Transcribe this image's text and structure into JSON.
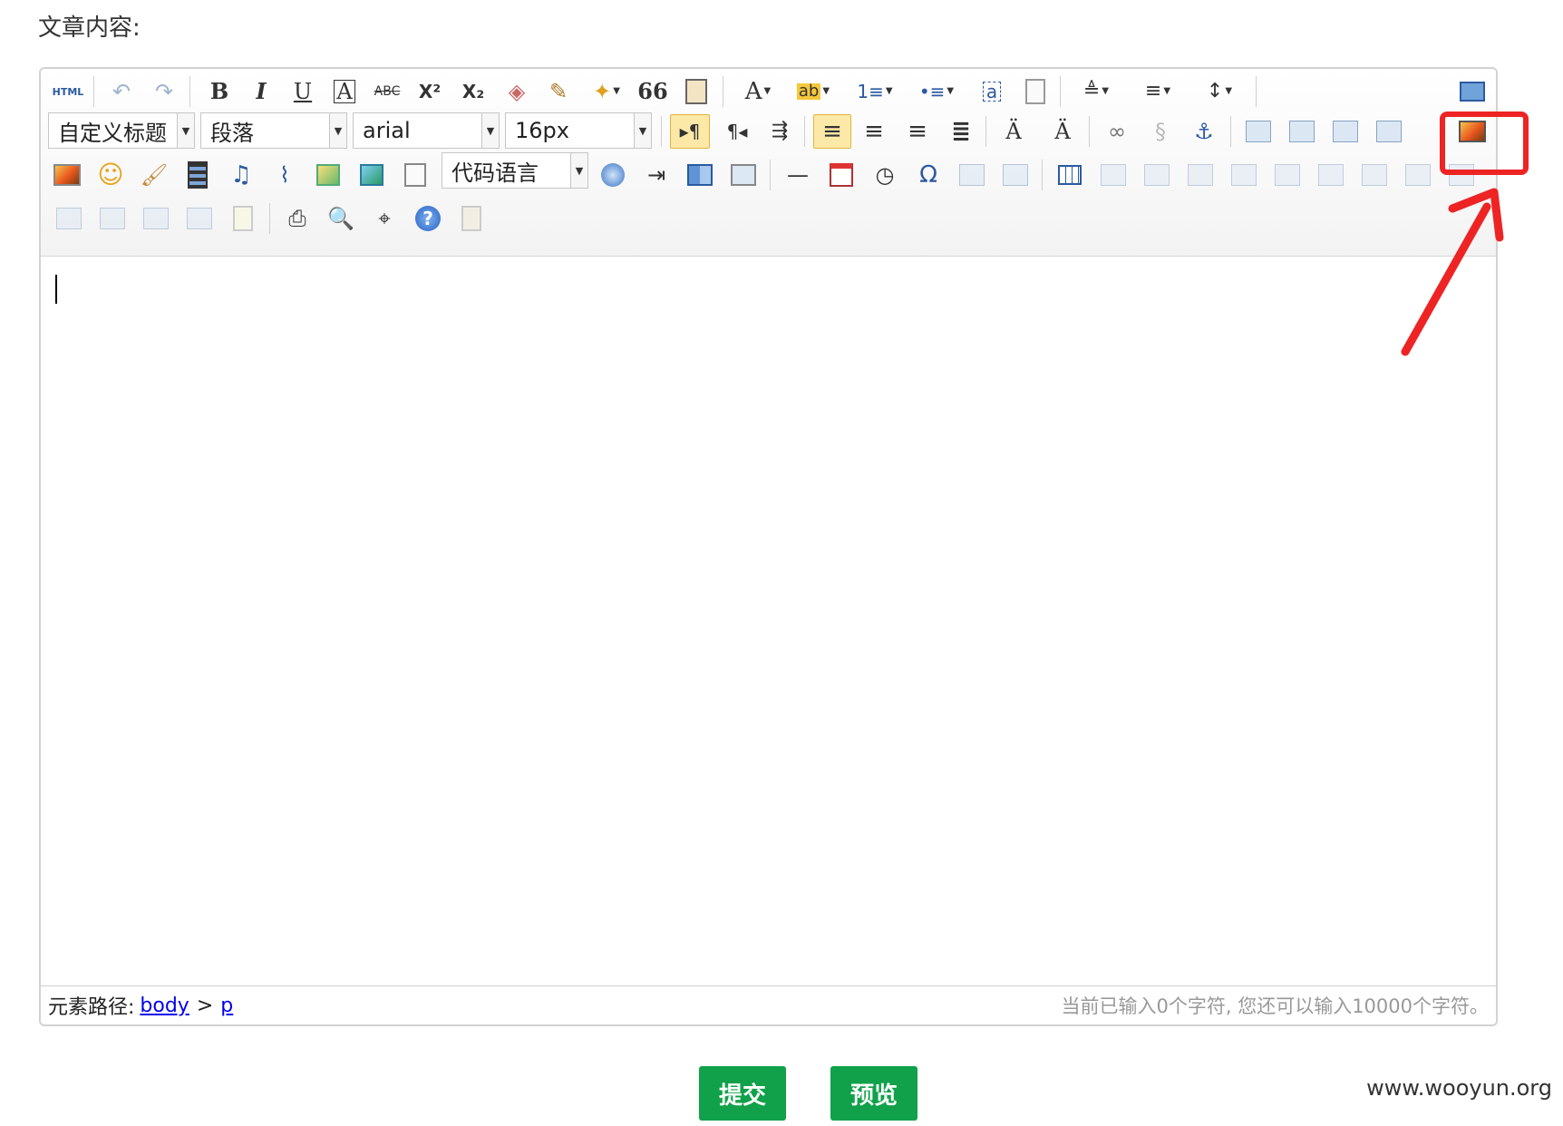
{
  "page": {
    "label": "文章内容:",
    "watermark": "www.wooyun.org"
  },
  "toolbar": {
    "html_label": "HTML",
    "combos": {
      "custom_heading": "自定义标题",
      "paragraph": "段落",
      "font_family": "arial",
      "font_size": "16px",
      "code_language": "代码语言"
    },
    "glyphs": {
      "bold": "B",
      "italic": "I",
      "underline": "U",
      "font_border": "A",
      "strikethrough": "ABC",
      "superscript": "X²",
      "subscript": "X₂",
      "blockquote": "66",
      "font_color": "A",
      "backcolor": "ab",
      "ordered_list": "1≡",
      "unordered_list": "•≡",
      "ltr": "▸¶",
      "rtl": "¶◂",
      "omega": "Ω",
      "help": "?",
      "horizontal": "—"
    },
    "row_icons": [
      [
        "html-source-icon",
        "undo-icon",
        "redo-icon",
        "bold-icon",
        "italic-icon",
        "underline-icon",
        "fontborder-icon",
        "strikethrough-icon",
        "superscript-icon",
        "subscript-icon",
        "eraser-icon",
        "format-brush-icon",
        "auto-format-icon",
        "blockquote-icon",
        "paste-plain-icon",
        "font-color-icon",
        "background-color-icon",
        "ordered-list-icon",
        "unordered-list-icon",
        "select-all-icon",
        "clear-doc-icon",
        "row-spacing-top-icon",
        "row-spacing-bottom-icon",
        "line-height-icon",
        "fullscreen-icon"
      ],
      [
        "custom-heading-select",
        "paragraph-select",
        "font-family-select",
        "font-size-select",
        "direction-ltr-icon",
        "direction-rtl-icon",
        "indent-icon",
        "justify-left-icon",
        "justify-center-icon",
        "justify-right-icon",
        "justify-full-icon",
        "touppercase-icon",
        "tolowercase-icon",
        "link-icon",
        "unlink-icon",
        "anchor-icon",
        "image-none-icon",
        "image-left-icon",
        "image-right-icon",
        "image-center-icon",
        "insert-image-icon"
      ],
      [
        "simple-upload-icon",
        "emotion-icon",
        "scrawl-icon",
        "insert-video-icon",
        "music-icon",
        "attachment-icon",
        "map-icon",
        "gmap-icon",
        "insert-frame-icon",
        "code-language-select",
        "page-break-icon",
        "template-icon",
        "background-icon",
        "horizontal-rule-icon",
        "date-icon",
        "time-icon",
        "special-chars-icon",
        "snapscreen-icon",
        "word-image-icon",
        "insert-table-icon",
        "delete-table-icon",
        "insert-caption-icon",
        "insert-row-icon",
        "delete-row-icon",
        "insert-col-icon",
        "delete-col-icon",
        "merge-cells-icon",
        "merge-right-icon"
      ],
      [
        "merge-down-icon",
        "split-to-cells-icon",
        "split-to-rows-icon",
        "split-to-cols-icon",
        "chart-icon",
        "print-icon",
        "preview-icon",
        "search-replace-icon",
        "help-icon",
        "drafts-icon"
      ]
    ]
  },
  "status": {
    "path_label": "元素路径:",
    "path_body": "body",
    "path_separator": ">",
    "path_p": "p",
    "counter": "当前已输入0个字符, 您还可以输入10000个字符。"
  },
  "buttons": {
    "submit": "提交",
    "preview": "预览"
  },
  "annotation": {
    "color": "#ee2424"
  }
}
